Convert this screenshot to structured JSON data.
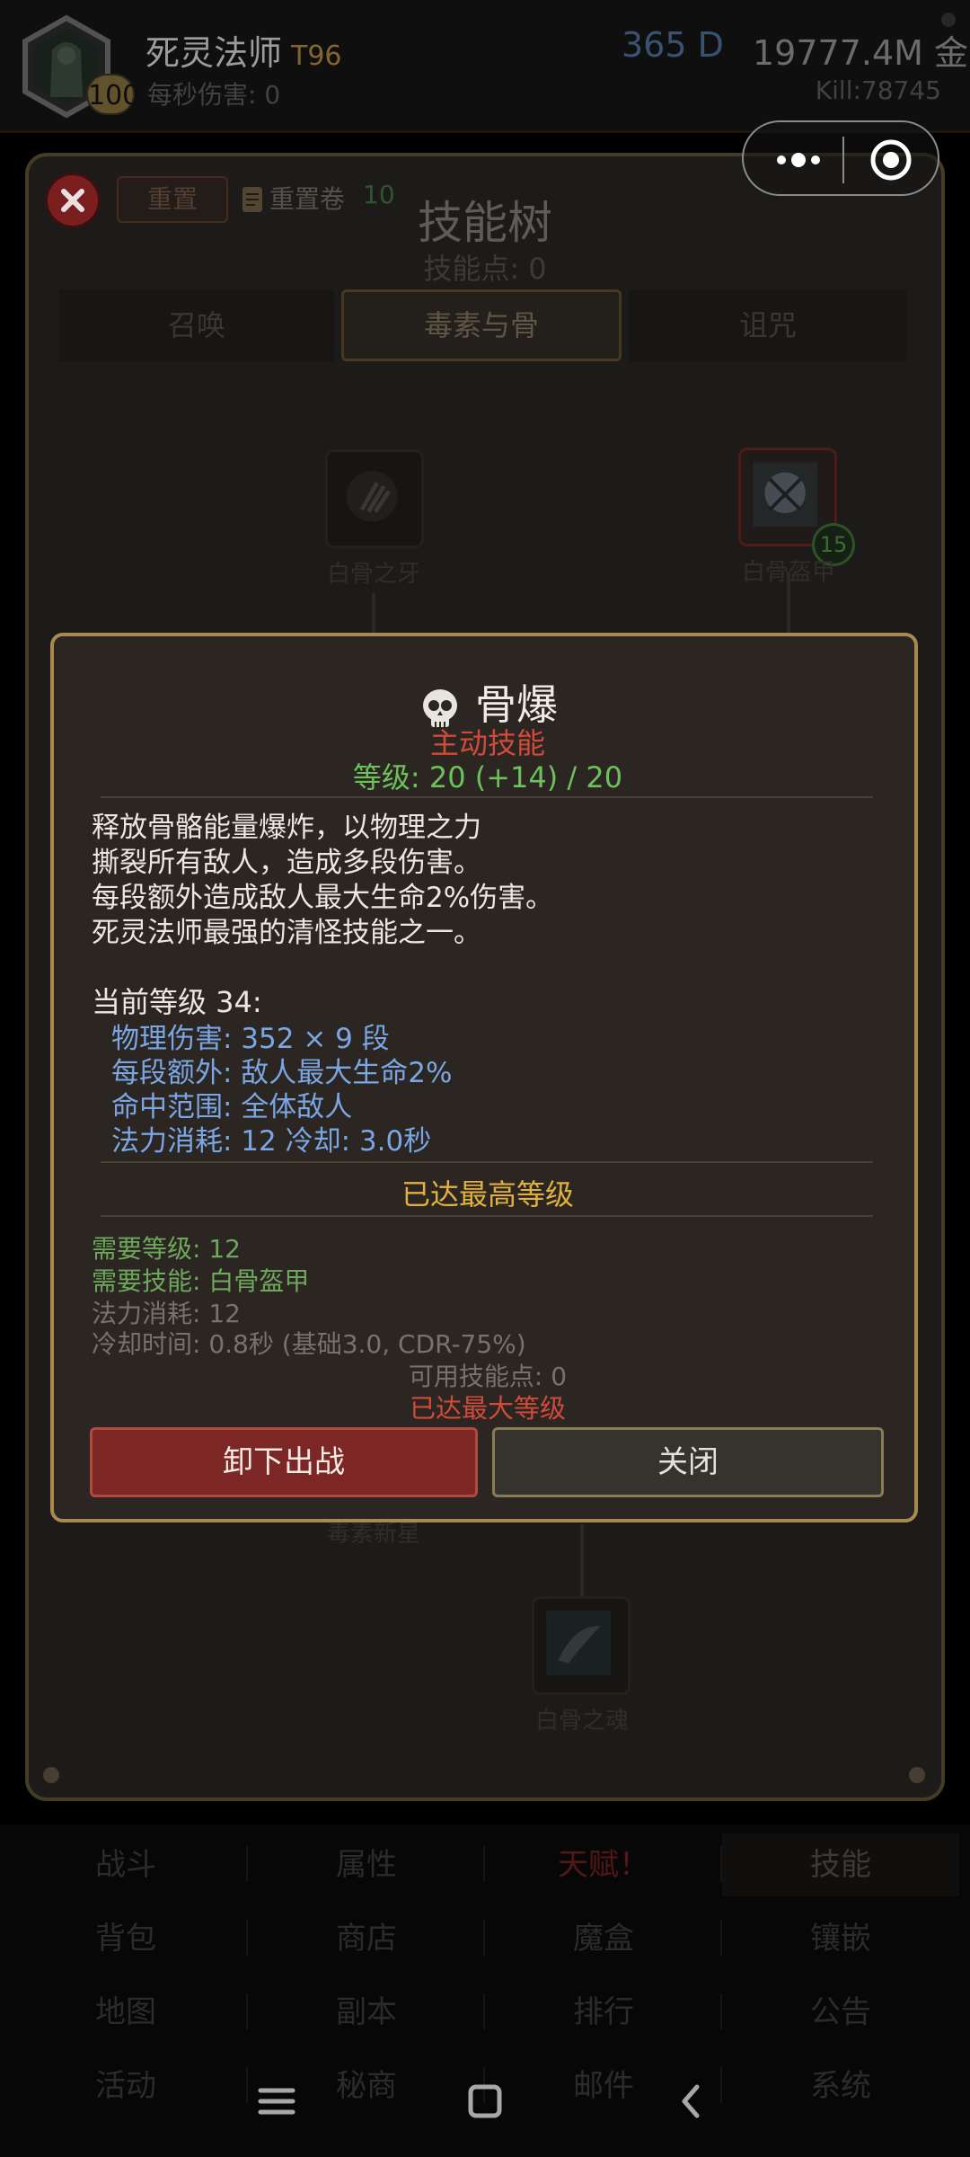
{
  "player": {
    "name": "死灵法师",
    "tier": "T96",
    "level": "100",
    "dps": "每秒伤害: 0",
    "diamonds": "365 D",
    "gold": "19777.4M 金",
    "kills": "Kill:78745"
  },
  "skill_tree": {
    "reset_label": "重置",
    "reset_scroll_label": "重置卷",
    "reset_scroll_count": "10",
    "title": "技能树",
    "points": "技能点: 0",
    "tabs": [
      {
        "label": "召唤"
      },
      {
        "label": "毒素与骨",
        "selected": true
      },
      {
        "label": "诅咒"
      }
    ],
    "nodes": [
      {
        "label": "白骨之牙"
      },
      {
        "label": "白骨盔甲",
        "badge": "15"
      },
      {
        "label": "毒素新星"
      },
      {
        "label": "白骨之魂"
      }
    ]
  },
  "skill_detail": {
    "name": "骨爆",
    "type": "主动技能",
    "level": "等级: 20 (+14) / 20",
    "description": [
      "释放骨骼能量爆炸，以物理之力",
      "撕裂所有敌人，造成多段伤害。",
      "每段额外造成敌人最大生命2%伤害。",
      "死灵法师最强的清怪技能之一。"
    ],
    "current_level": "当前等级 34:",
    "stats": [
      "物理伤害: 352 × 9 段",
      "每段额外: 敌人最大生命2%",
      "命中范围: 全体敌人",
      "法力消耗: 12  冷却: 3.0秒"
    ],
    "max_reached": "已达最高等级",
    "req_level": "需要等级: 12",
    "req_skill": "需要技能: 白骨盔甲",
    "mana_cost": "法力消耗: 12",
    "cooldown": "冷却时间: 0.8秒 (基础3.0, CDR-75%)",
    "available_points": "可用技能点: 0",
    "max_level_note": "已达最大等级",
    "unequip_label": "卸下出战",
    "close_label": "关闭"
  },
  "bottom_nav": [
    [
      "战斗",
      "属性",
      "天赋！",
      "技能"
    ],
    [
      "背包",
      "商店",
      "魔盒",
      "镶嵌"
    ],
    [
      "地图",
      "副本",
      "排行",
      "公告"
    ],
    [
      "活动",
      "秘商",
      "邮件",
      "系统"
    ]
  ],
  "colors": {
    "active_red": "#d24a3a",
    "level_green": "#6ec05c",
    "stat_blue": "#7aa6e4",
    "max_gold": "#e2b040",
    "modal_border": "#a88a50"
  }
}
